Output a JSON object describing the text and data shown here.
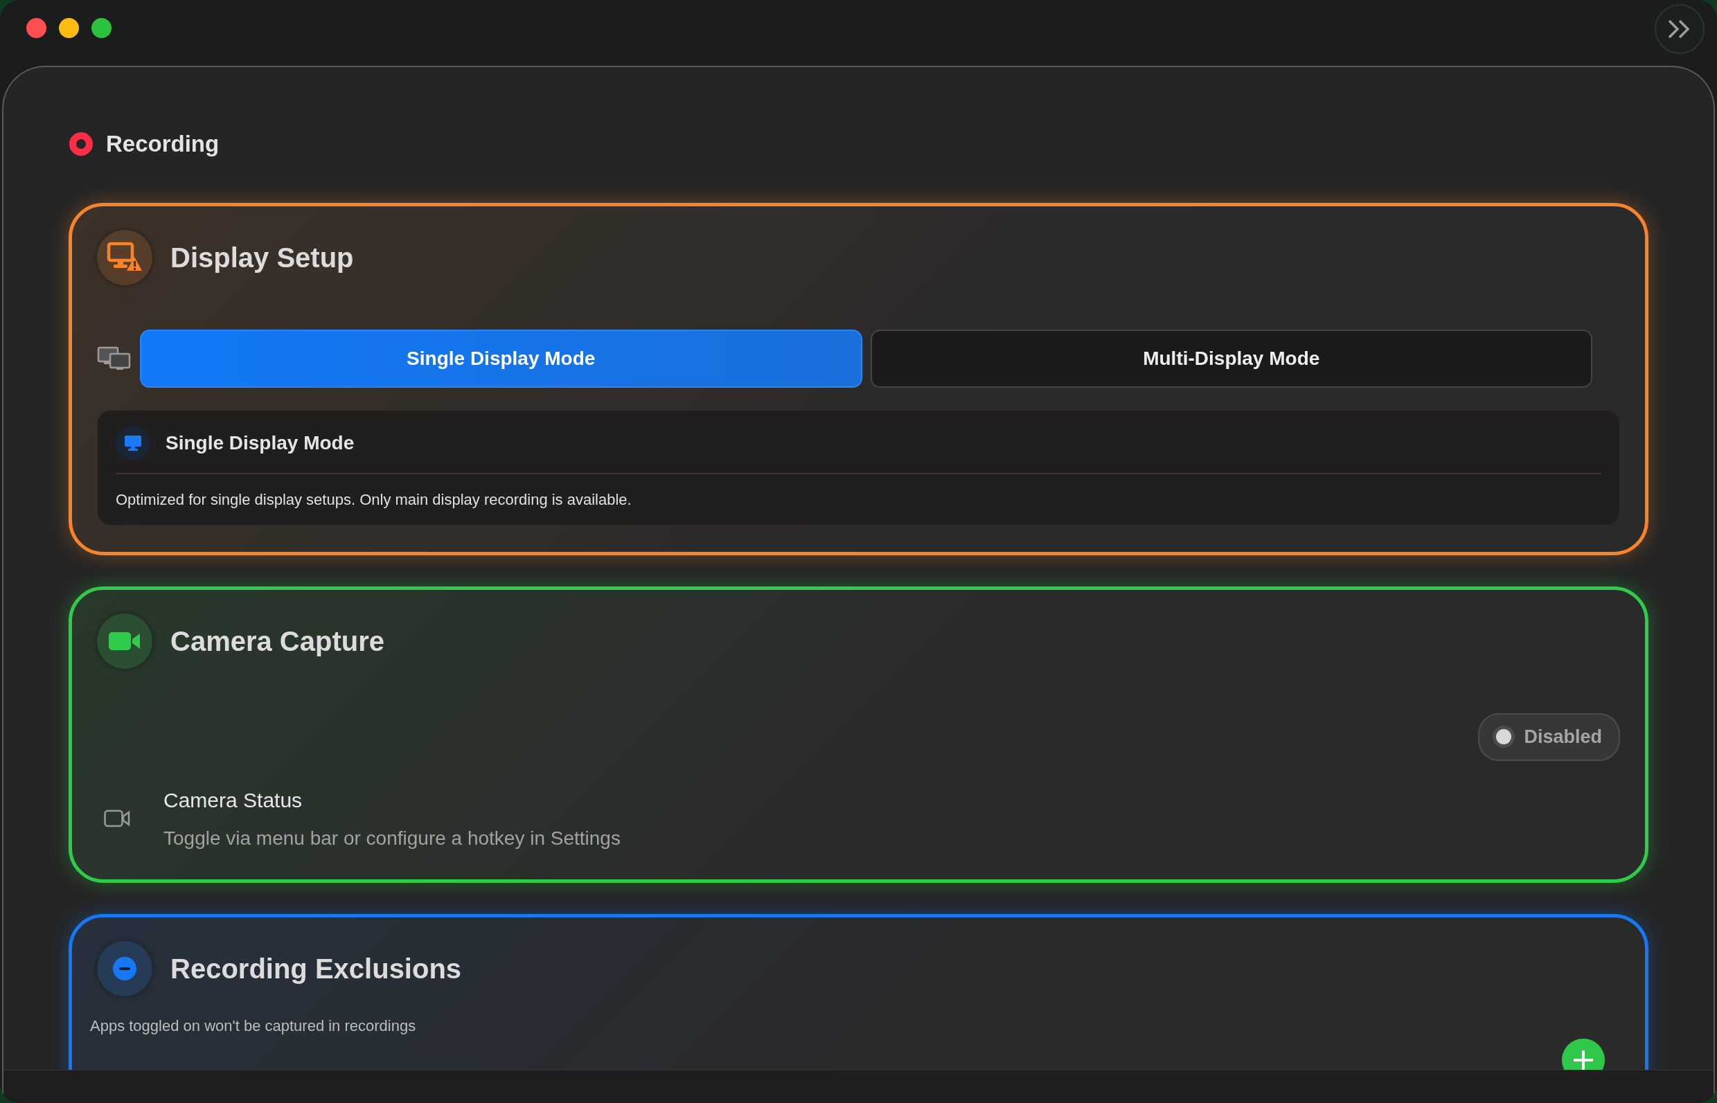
{
  "window": {
    "controls": [
      {
        "color": "#fe4e52"
      },
      {
        "color": "#fdbc12"
      },
      {
        "color": "#2dc23e"
      }
    ]
  },
  "header": {
    "title": "Recording"
  },
  "sections": [
    {
      "kind": "display",
      "title": "Display Setup",
      "color": "#f7842b",
      "modes": [
        {
          "label": "Single Display Mode",
          "selected": true
        },
        {
          "label": "Multi-Display Mode",
          "selected": false
        }
      ],
      "info": {
        "title": "Single Display Mode",
        "description": "Optimized for single display setups. Only main display recording is available."
      }
    },
    {
      "kind": "camera",
      "title": "Camera Capture",
      "color": "#30cb4a",
      "badge": {
        "label": "Disabled",
        "on": false
      },
      "status": {
        "title": "Camera Status",
        "description": "Toggle via menu bar or configure a hotkey in Settings"
      }
    },
    {
      "kind": "exclusions",
      "title": "Recording Exclusions",
      "color": "#1877f2",
      "description": "Apps toggled on won't be captured in recordings"
    }
  ]
}
